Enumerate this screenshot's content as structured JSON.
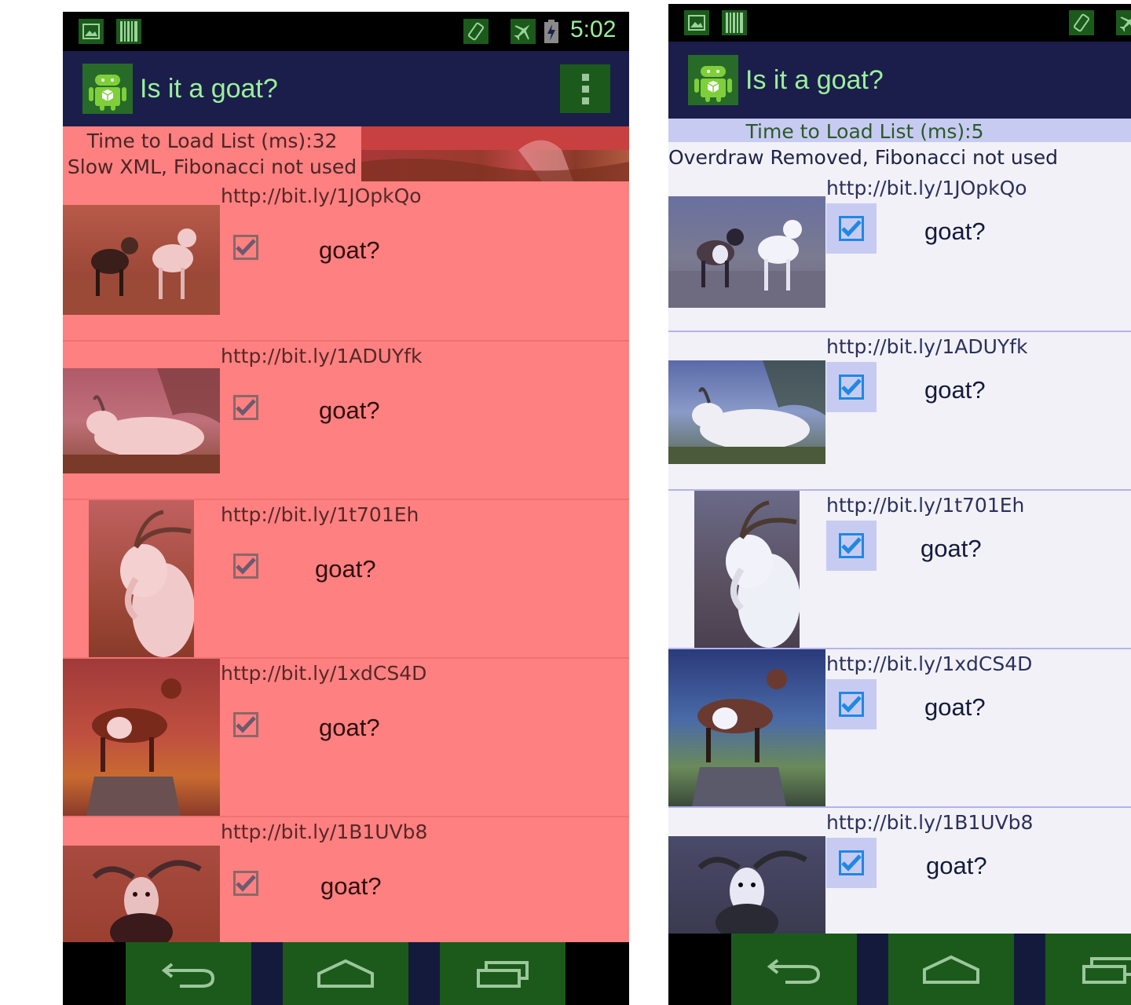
{
  "colors": {
    "overdraw_red": "#ff8080",
    "overdraw_blue": "#c8cbf1",
    "action_bar": "#1b1e4b",
    "accent_green": "#9bf09b",
    "checkbox_blue": "#1e88e5"
  },
  "left_screen": {
    "status_bar": {
      "time": "5:02",
      "icons": [
        "image-icon",
        "barcode-icon",
        "vibrate-icon",
        "airplane-icon",
        "battery-charging-icon"
      ]
    },
    "action_bar": {
      "title": "Is it a goat?",
      "app_icon": "android-icon",
      "overflow_icon": "overflow-menu-icon"
    },
    "info": {
      "load_time": "Time to Load List (ms):32",
      "mode": "Slow XML, Fibonacci not used"
    },
    "rows": [
      {
        "url": "http://bit.ly/1JOpkQo",
        "label": "goat?",
        "checked": true
      },
      {
        "url": "http://bit.ly/1ADUYfk",
        "label": "goat?",
        "checked": true
      },
      {
        "url": "http://bit.ly/1t701Eh",
        "label": "goat?",
        "checked": true
      },
      {
        "url": "http://bit.ly/1xdCS4D",
        "label": "goat?",
        "checked": true
      },
      {
        "url": "http://bit.ly/1B1UVb8",
        "label": "goat?",
        "checked": true
      }
    ],
    "nav_bar": [
      "back-icon",
      "home-icon",
      "recents-icon"
    ]
  },
  "right_screen": {
    "status_bar": {
      "icons": [
        "image-icon",
        "barcode-icon",
        "vibrate-icon",
        "airplane-icon"
      ]
    },
    "action_bar": {
      "title": "Is it a goat?",
      "app_icon": "android-icon"
    },
    "info": {
      "load_time": "Time to Load List (ms):5",
      "mode": "Overdraw Removed, Fibonacci not used"
    },
    "rows": [
      {
        "url": "http://bit.ly/1JOpkQo",
        "label": "goat?",
        "checked": true
      },
      {
        "url": "http://bit.ly/1ADUYfk",
        "label": "goat?",
        "checked": true
      },
      {
        "url": "http://bit.ly/1t701Eh",
        "label": "goat?",
        "checked": true
      },
      {
        "url": "http://bit.ly/1xdCS4D",
        "label": "goat?",
        "checked": true
      },
      {
        "url": "http://bit.ly/1B1UVb8",
        "label": "goat?",
        "checked": true
      }
    ],
    "nav_bar": [
      "back-icon",
      "home-icon",
      "recents-icon"
    ]
  }
}
